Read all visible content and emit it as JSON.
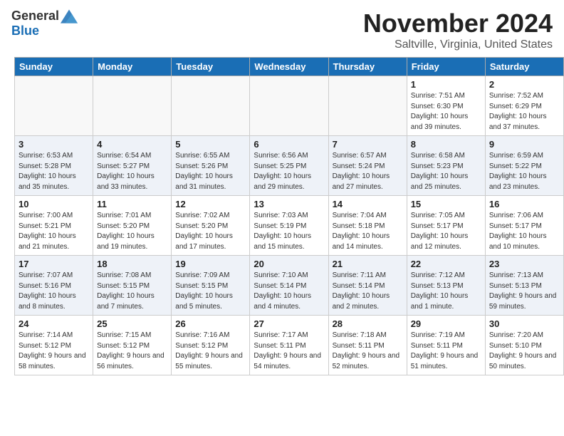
{
  "header": {
    "logo_general": "General",
    "logo_blue": "Blue",
    "month_title": "November 2024",
    "location": "Saltville, Virginia, United States"
  },
  "days_of_week": [
    "Sunday",
    "Monday",
    "Tuesday",
    "Wednesday",
    "Thursday",
    "Friday",
    "Saturday"
  ],
  "weeks": [
    [
      {
        "day": "",
        "info": ""
      },
      {
        "day": "",
        "info": ""
      },
      {
        "day": "",
        "info": ""
      },
      {
        "day": "",
        "info": ""
      },
      {
        "day": "",
        "info": ""
      },
      {
        "day": "1",
        "info": "Sunrise: 7:51 AM\nSunset: 6:30 PM\nDaylight: 10 hours and 39 minutes."
      },
      {
        "day": "2",
        "info": "Sunrise: 7:52 AM\nSunset: 6:29 PM\nDaylight: 10 hours and 37 minutes."
      }
    ],
    [
      {
        "day": "3",
        "info": "Sunrise: 6:53 AM\nSunset: 5:28 PM\nDaylight: 10 hours and 35 minutes."
      },
      {
        "day": "4",
        "info": "Sunrise: 6:54 AM\nSunset: 5:27 PM\nDaylight: 10 hours and 33 minutes."
      },
      {
        "day": "5",
        "info": "Sunrise: 6:55 AM\nSunset: 5:26 PM\nDaylight: 10 hours and 31 minutes."
      },
      {
        "day": "6",
        "info": "Sunrise: 6:56 AM\nSunset: 5:25 PM\nDaylight: 10 hours and 29 minutes."
      },
      {
        "day": "7",
        "info": "Sunrise: 6:57 AM\nSunset: 5:24 PM\nDaylight: 10 hours and 27 minutes."
      },
      {
        "day": "8",
        "info": "Sunrise: 6:58 AM\nSunset: 5:23 PM\nDaylight: 10 hours and 25 minutes."
      },
      {
        "day": "9",
        "info": "Sunrise: 6:59 AM\nSunset: 5:22 PM\nDaylight: 10 hours and 23 minutes."
      }
    ],
    [
      {
        "day": "10",
        "info": "Sunrise: 7:00 AM\nSunset: 5:21 PM\nDaylight: 10 hours and 21 minutes."
      },
      {
        "day": "11",
        "info": "Sunrise: 7:01 AM\nSunset: 5:20 PM\nDaylight: 10 hours and 19 minutes."
      },
      {
        "day": "12",
        "info": "Sunrise: 7:02 AM\nSunset: 5:20 PM\nDaylight: 10 hours and 17 minutes."
      },
      {
        "day": "13",
        "info": "Sunrise: 7:03 AM\nSunset: 5:19 PM\nDaylight: 10 hours and 15 minutes."
      },
      {
        "day": "14",
        "info": "Sunrise: 7:04 AM\nSunset: 5:18 PM\nDaylight: 10 hours and 14 minutes."
      },
      {
        "day": "15",
        "info": "Sunrise: 7:05 AM\nSunset: 5:17 PM\nDaylight: 10 hours and 12 minutes."
      },
      {
        "day": "16",
        "info": "Sunrise: 7:06 AM\nSunset: 5:17 PM\nDaylight: 10 hours and 10 minutes."
      }
    ],
    [
      {
        "day": "17",
        "info": "Sunrise: 7:07 AM\nSunset: 5:16 PM\nDaylight: 10 hours and 8 minutes."
      },
      {
        "day": "18",
        "info": "Sunrise: 7:08 AM\nSunset: 5:15 PM\nDaylight: 10 hours and 7 minutes."
      },
      {
        "day": "19",
        "info": "Sunrise: 7:09 AM\nSunset: 5:15 PM\nDaylight: 10 hours and 5 minutes."
      },
      {
        "day": "20",
        "info": "Sunrise: 7:10 AM\nSunset: 5:14 PM\nDaylight: 10 hours and 4 minutes."
      },
      {
        "day": "21",
        "info": "Sunrise: 7:11 AM\nSunset: 5:14 PM\nDaylight: 10 hours and 2 minutes."
      },
      {
        "day": "22",
        "info": "Sunrise: 7:12 AM\nSunset: 5:13 PM\nDaylight: 10 hours and 1 minute."
      },
      {
        "day": "23",
        "info": "Sunrise: 7:13 AM\nSunset: 5:13 PM\nDaylight: 9 hours and 59 minutes."
      }
    ],
    [
      {
        "day": "24",
        "info": "Sunrise: 7:14 AM\nSunset: 5:12 PM\nDaylight: 9 hours and 58 minutes."
      },
      {
        "day": "25",
        "info": "Sunrise: 7:15 AM\nSunset: 5:12 PM\nDaylight: 9 hours and 56 minutes."
      },
      {
        "day": "26",
        "info": "Sunrise: 7:16 AM\nSunset: 5:12 PM\nDaylight: 9 hours and 55 minutes."
      },
      {
        "day": "27",
        "info": "Sunrise: 7:17 AM\nSunset: 5:11 PM\nDaylight: 9 hours and 54 minutes."
      },
      {
        "day": "28",
        "info": "Sunrise: 7:18 AM\nSunset: 5:11 PM\nDaylight: 9 hours and 52 minutes."
      },
      {
        "day": "29",
        "info": "Sunrise: 7:19 AM\nSunset: 5:11 PM\nDaylight: 9 hours and 51 minutes."
      },
      {
        "day": "30",
        "info": "Sunrise: 7:20 AM\nSunset: 5:10 PM\nDaylight: 9 hours and 50 minutes."
      }
    ]
  ]
}
